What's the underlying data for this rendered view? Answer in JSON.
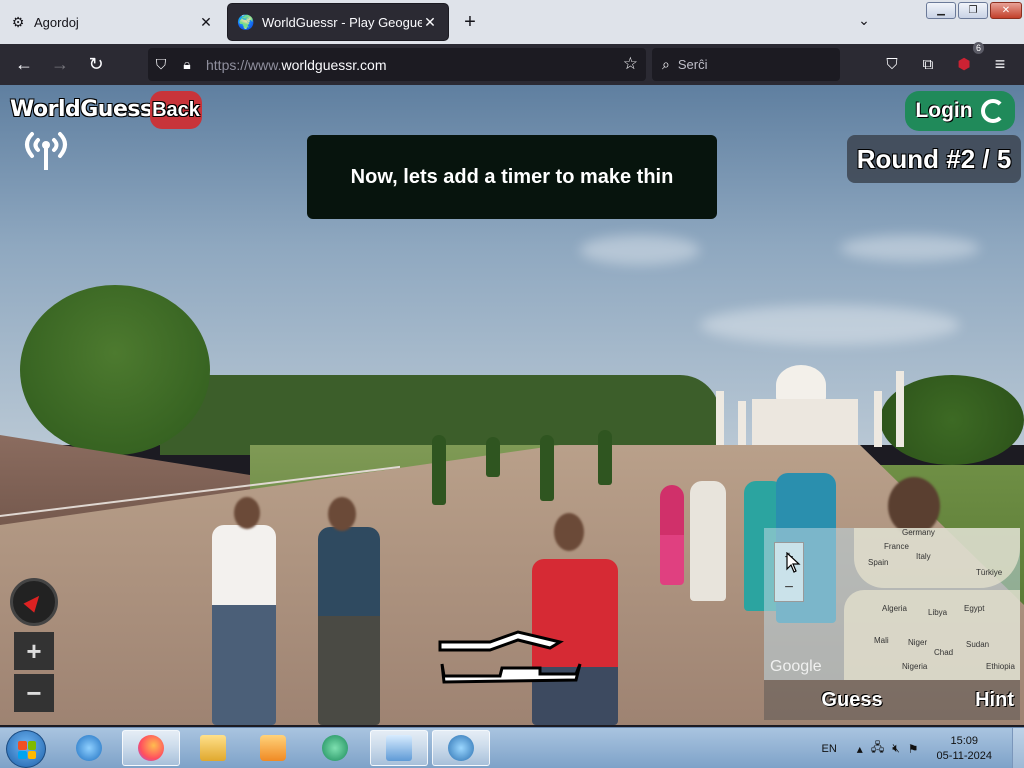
{
  "browser": {
    "tabs": [
      {
        "label": "Agordoj",
        "icon": "gear-icon"
      },
      {
        "label": "WorldGuessr - Play Geoguessr Free",
        "icon": "globe-icon"
      }
    ],
    "url_protocol": "https://www.",
    "url_domain": "worldguessr.com",
    "search_placeholder": "Serĉi",
    "extension_badge": "6"
  },
  "game": {
    "logo": "WorldGuessr",
    "back_label": "Back",
    "login_label": "Login",
    "round_label": "Round #2 / 5",
    "toast_message": "Now, lets add a timer to make thin",
    "guess_label": "Guess",
    "hint_label": "Hint",
    "map_attribution": "Google",
    "map_labels": [
      "Germany",
      "France",
      "Italy",
      "Spain",
      "Türkiye",
      "Algeria",
      "Libya",
      "Egypt",
      "Mali",
      "Niger",
      "Chad",
      "Sudan",
      "Nigeria",
      "Ethiopia"
    ]
  },
  "taskbar": {
    "lang": "EN",
    "time": "15:09",
    "date": "05-11-2024"
  }
}
